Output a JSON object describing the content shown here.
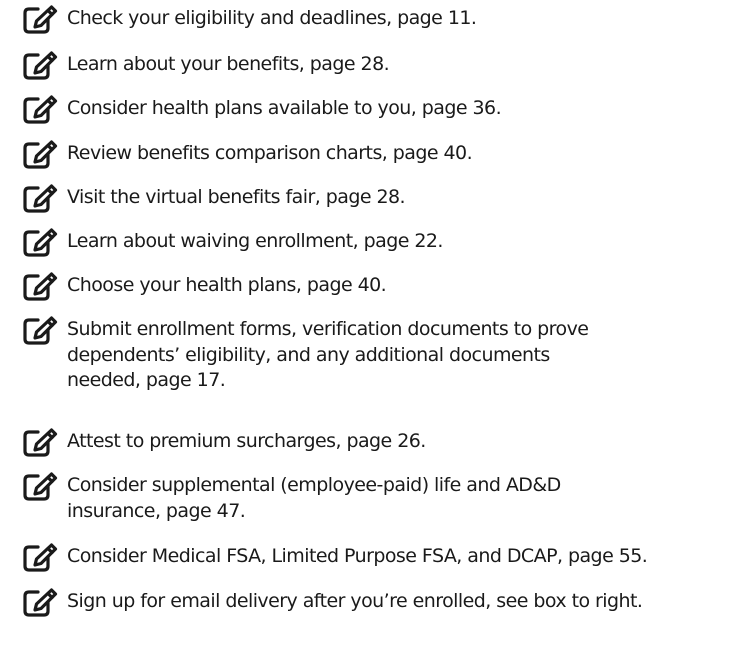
{
  "checklist": {
    "icon": "pencil-square-icon",
    "items": [
      {
        "text": "Check your eligibility and deadlines, page 11."
      },
      {
        "text": "Learn about your benefits, page 28."
      },
      {
        "text": "Consider health plans available to you, page 36."
      },
      {
        "text": "Review benefits comparison charts, page 40."
      },
      {
        "text": "Visit the virtual benefits fair, page 28."
      },
      {
        "text": "Learn about waiving enrollment, page 22."
      },
      {
        "text": "Choose your health plans, page 40."
      },
      {
        "text": "Submit enrollment forms, verification documents to prove dependents’ eligibility, and any additional documents needed, page 17."
      },
      {
        "text": "Attest to premium surcharges, page 26."
      },
      {
        "text": "Consider supplemental (employee-paid) life and AD&D insurance, page 47."
      },
      {
        "text": "Consider Medical FSA, Limited Purpose FSA, and DCAP, page 55."
      },
      {
        "text": "Sign up for email delivery after you’re enrolled, see box to right."
      }
    ]
  }
}
